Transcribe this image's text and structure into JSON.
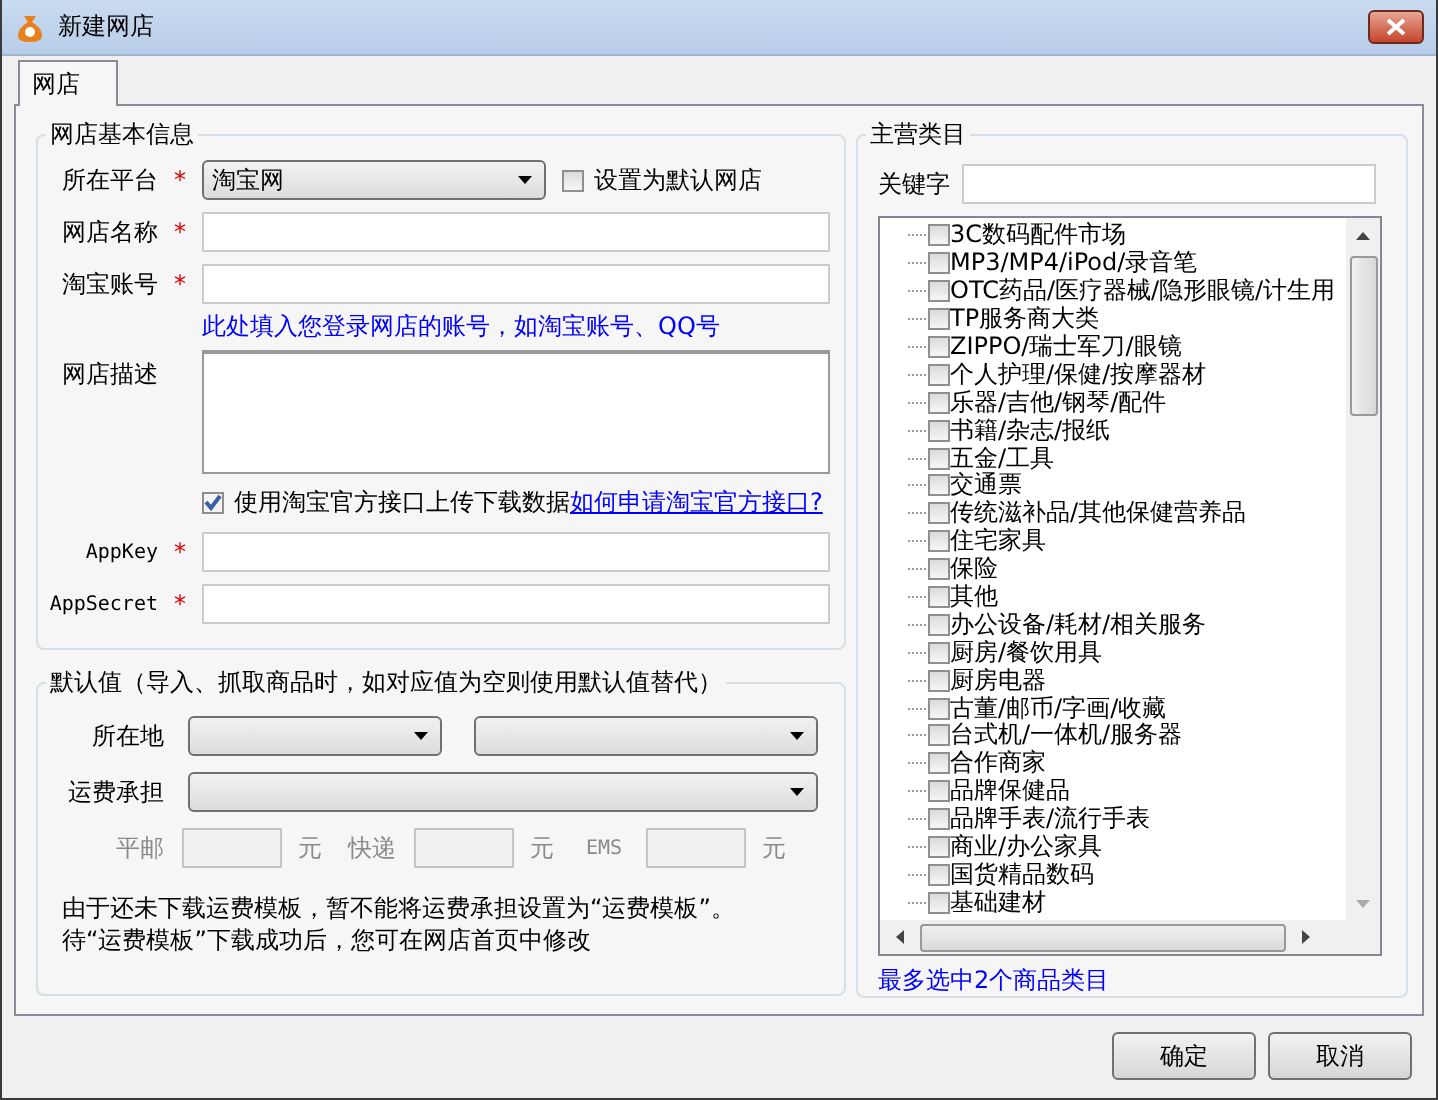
{
  "window": {
    "title": "新建网店"
  },
  "tabs": [
    {
      "label": "网店",
      "selected": true
    }
  ],
  "basic_info": {
    "title": "网店基本信息",
    "platform": {
      "label": "所在平台",
      "marker": "*",
      "value": "淘宝网"
    },
    "default_shop": {
      "label": "设置为默认网店",
      "checked": false
    },
    "shop_name": {
      "label": "网店名称",
      "marker": "*"
    },
    "account": {
      "label": "淘宝账号",
      "marker": "*",
      "hint": "此处填入您登录网店的账号，如淘宝账号、QQ号"
    },
    "description": {
      "label": "网店描述"
    },
    "official_api": {
      "label": "使用淘宝官方接口上传下载数据",
      "link": "如何申请淘宝官方接口?",
      "checked": true
    },
    "app_key": {
      "label": "AppKey",
      "marker": "*"
    },
    "app_secret": {
      "label": "AppSecret",
      "marker": "*"
    }
  },
  "defaults": {
    "title": "默认值（导入、抓取商品时，如对应值为空则使用默认值替代）",
    "location": {
      "label": "所在地"
    },
    "shipping": {
      "label": "运费承担"
    },
    "fees": [
      {
        "label": "平邮",
        "unit": "元"
      },
      {
        "label": "快递",
        "unit": "元"
      },
      {
        "label": "EMS",
        "unit": "元"
      }
    ],
    "note": [
      "由于还未下载运费模板，暂不能将运费承担设置为“运费模板”。",
      "待“运费模板”下载成功后，您可在网店首页中修改"
    ]
  },
  "categories": {
    "title": "主营类目",
    "keyword_label": "关键字",
    "items": [
      {
        "label": "3C数码配件市场",
        "checked": false
      },
      {
        "label": "MP3/MP4/iPod/录音笔",
        "checked": false
      },
      {
        "label": "OTC药品/医疗器械/隐形眼镜/计生用",
        "checked": false
      },
      {
        "label": "TP服务商大类",
        "checked": false
      },
      {
        "label": "ZIPPO/瑞士军刀/眼镜",
        "checked": false
      },
      {
        "label": "个人护理/保健/按摩器材",
        "checked": false
      },
      {
        "label": "乐器/吉他/钢琴/配件",
        "checked": false
      },
      {
        "label": "书籍/杂志/报纸",
        "checked": false
      },
      {
        "label": "五金/工具",
        "checked": false
      },
      {
        "label": "交通票",
        "checked": false
      },
      {
        "label": "传统滋补品/其他保健营养品",
        "checked": false
      },
      {
        "label": "住宅家具",
        "checked": false
      },
      {
        "label": "保险",
        "checked": false
      },
      {
        "label": "其他",
        "checked": false
      },
      {
        "label": "办公设备/耗材/相关服务",
        "checked": false
      },
      {
        "label": "厨房/餐饮用具",
        "checked": false
      },
      {
        "label": "厨房电器",
        "checked": false
      },
      {
        "label": "古董/邮币/字画/收藏",
        "checked": false
      },
      {
        "label": "台式机/一体机/服务器",
        "checked": false
      },
      {
        "label": "合作商家",
        "checked": false
      },
      {
        "label": "品牌保健品",
        "checked": false
      },
      {
        "label": "品牌手表/流行手表",
        "checked": false
      },
      {
        "label": "商业/办公家具",
        "checked": false
      },
      {
        "label": "国货精品数码",
        "checked": false
      },
      {
        "label": "基础建材",
        "checked": false
      }
    ],
    "limit_note": "最多选中2个商品类目"
  },
  "buttons": [
    "确定",
    "取消"
  ]
}
